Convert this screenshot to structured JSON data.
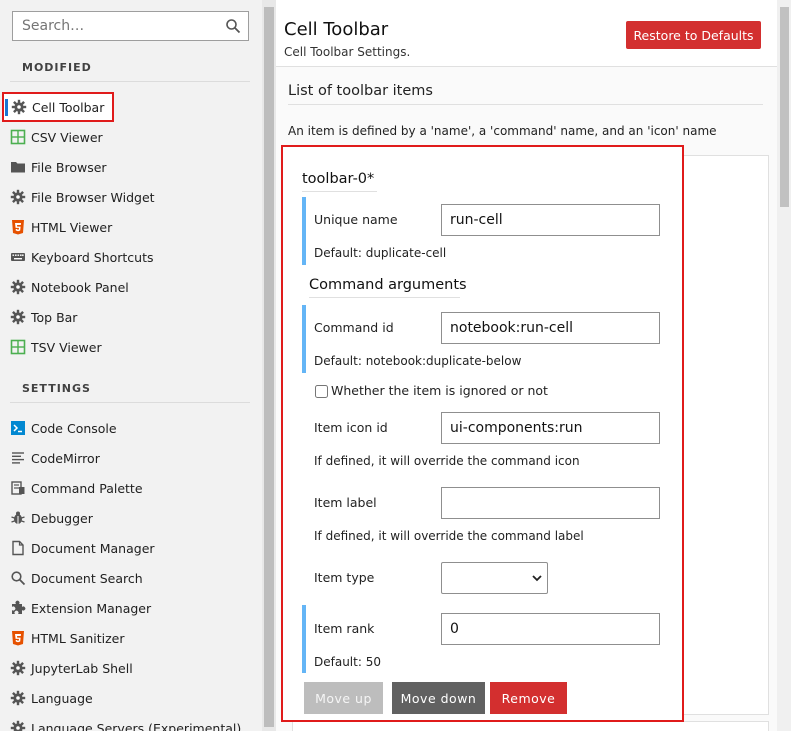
{
  "search": {
    "placeholder": "Search…"
  },
  "sidebar": {
    "modified_header": "MODIFIED",
    "settings_header": "SETTINGS",
    "modified_items": [
      {
        "label": "Cell Toolbar",
        "icon": "gear-icon"
      },
      {
        "label": "CSV Viewer",
        "icon": "spreadsheet-icon"
      },
      {
        "label": "File Browser",
        "icon": "folder-icon"
      },
      {
        "label": "File Browser Widget",
        "icon": "gear-icon"
      },
      {
        "label": "HTML Viewer",
        "icon": "html5-icon"
      },
      {
        "label": "Keyboard Shortcuts",
        "icon": "keyboard-icon"
      },
      {
        "label": "Notebook Panel",
        "icon": "gear-icon"
      },
      {
        "label": "Top Bar",
        "icon": "gear-icon"
      },
      {
        "label": "TSV Viewer",
        "icon": "spreadsheet-icon"
      }
    ],
    "settings_items": [
      {
        "label": "Code Console",
        "icon": "console-icon"
      },
      {
        "label": "CodeMirror",
        "icon": "text-editor-icon"
      },
      {
        "label": "Command Palette",
        "icon": "palette-icon"
      },
      {
        "label": "Debugger",
        "icon": "bug-icon"
      },
      {
        "label": "Document Manager",
        "icon": "file-icon"
      },
      {
        "label": "Document Search",
        "icon": "search-icon"
      },
      {
        "label": "Extension Manager",
        "icon": "puzzle-icon"
      },
      {
        "label": "HTML Sanitizer",
        "icon": "html5-icon"
      },
      {
        "label": "JupyterLab Shell",
        "icon": "gear-icon"
      },
      {
        "label": "Language",
        "icon": "gear-icon"
      },
      {
        "label": "Language Servers (Experimental)",
        "icon": "gear-icon"
      }
    ]
  },
  "header": {
    "title": "Cell Toolbar",
    "subtitle": "Cell Toolbar Settings.",
    "restore_label": "Restore to Defaults"
  },
  "list": {
    "title": "List of toolbar items",
    "description": "An item is defined by a 'name', a 'command' name, and an 'icon' name"
  },
  "item": {
    "name": "toolbar-0*",
    "unique_name_label": "Unique name",
    "unique_name_value": "run-cell",
    "unique_name_default": "Default: duplicate-cell",
    "command_args_title": "Command arguments",
    "command_id_label": "Command id",
    "command_id_value": "notebook:run-cell",
    "command_id_default": "Default: notebook:duplicate-below",
    "ignored_label": "Whether the item is ignored or not",
    "icon_id_label": "Item icon id",
    "icon_id_value": "ui-components:run",
    "icon_id_hint": "If defined, it will override the command icon",
    "item_label_label": "Item label",
    "item_label_value": "",
    "item_label_hint": "If defined, it will override the command label",
    "item_type_label": "Item type",
    "item_type_value": "",
    "item_rank_label": "Item rank",
    "item_rank_value": "0",
    "item_rank_default": "Default: 50",
    "move_up_label": "Move up",
    "move_down_label": "Move down",
    "remove_label": "Remove"
  },
  "colors": {
    "accent_red": "#d32f2f",
    "highlight_outline": "#e01b1b",
    "field_bar": "#64b5f6",
    "active_marker": "#1976d2"
  }
}
